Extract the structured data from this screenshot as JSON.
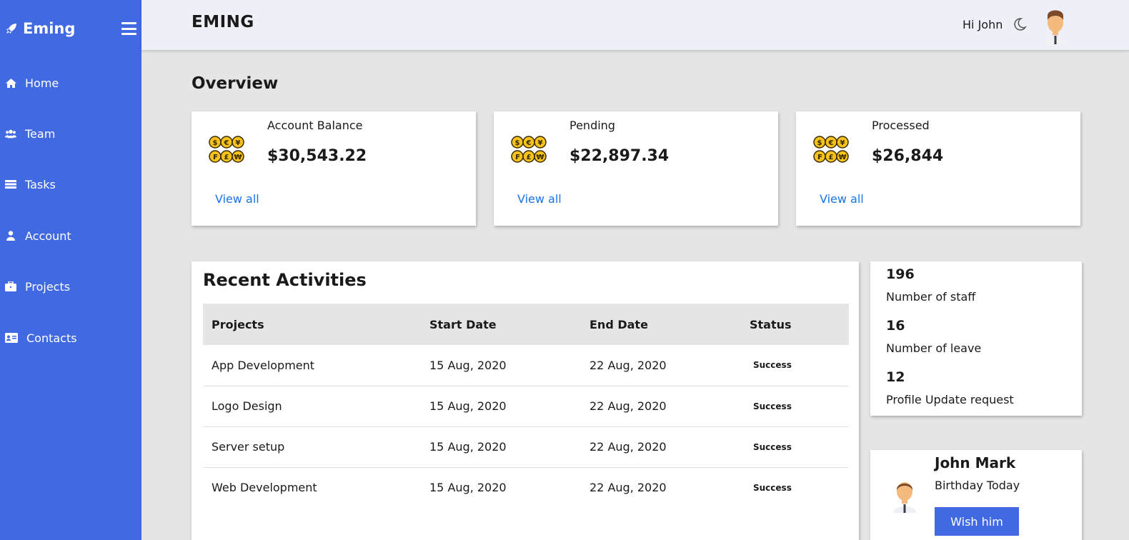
{
  "sidebar": {
    "brand": "Eming",
    "items": [
      {
        "label": "Home",
        "icon": "home-icon"
      },
      {
        "label": "Team",
        "icon": "users-icon"
      },
      {
        "label": "Tasks",
        "icon": "tasks-icon"
      },
      {
        "label": "Account",
        "icon": "user-icon"
      },
      {
        "label": "Projects",
        "icon": "briefcase-icon"
      },
      {
        "label": "Contacts",
        "icon": "contact-card-icon"
      }
    ]
  },
  "header": {
    "title": "EMING",
    "greeting": "Hi John"
  },
  "overview": {
    "title": "Overview",
    "cards": [
      {
        "label": "Account Balance",
        "value": "$30,543.22",
        "link": "View all"
      },
      {
        "label": "Pending",
        "value": "$22,897.34",
        "link": "View all"
      },
      {
        "label": "Processed",
        "value": "$26,844",
        "link": "View all"
      }
    ]
  },
  "activities": {
    "title": "Recent Activities",
    "columns": [
      "Projects",
      "Start Date",
      "End Date",
      "Status"
    ],
    "rows": [
      {
        "project": "App Development",
        "start": "15 Aug, 2020",
        "end": "22 Aug, 2020",
        "status": "Success"
      },
      {
        "project": "Logo Design",
        "start": "15 Aug, 2020",
        "end": "22 Aug, 2020",
        "status": "Success"
      },
      {
        "project": "Server setup",
        "start": "15 Aug, 2020",
        "end": "22 Aug, 2020",
        "status": "Success"
      },
      {
        "project": "Web Development",
        "start": "15 Aug, 2020",
        "end": "22 Aug, 2020",
        "status": "Success"
      }
    ]
  },
  "stats": [
    {
      "value": "196",
      "label": "Number of staff"
    },
    {
      "value": "16",
      "label": "Number of leave"
    },
    {
      "value": "12",
      "label": "Profile Update request"
    }
  ],
  "birthday": {
    "name": "John Mark",
    "subtitle": "Birthday Today",
    "button": "Wish him"
  },
  "colors": {
    "primary": "#4169e1",
    "link": "#1a73e8",
    "background": "#e5e5e5",
    "header_bg": "#eff0f7"
  }
}
